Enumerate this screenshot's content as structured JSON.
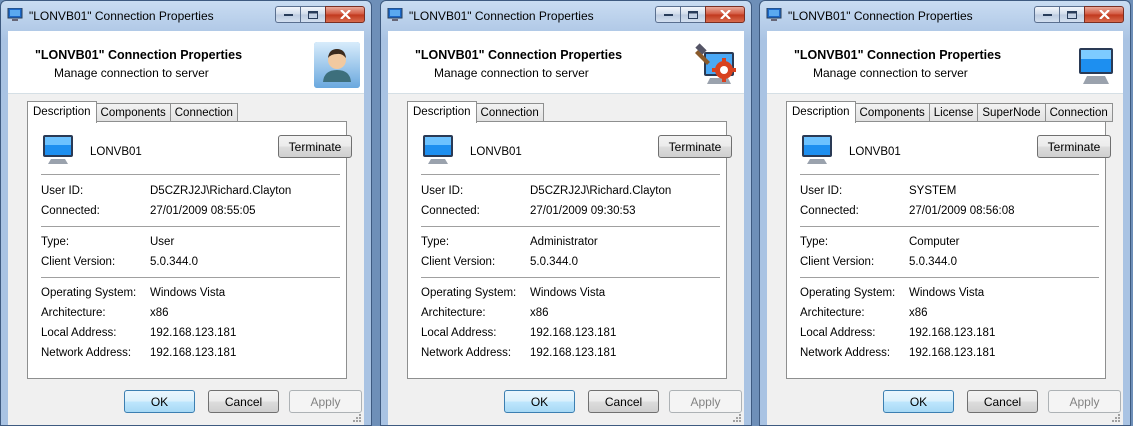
{
  "colors": {
    "accent": "#3c7fb1",
    "chrome": "#a9c3e3",
    "close_red": "#c0371c"
  },
  "windows": [
    {
      "title": "\"LONVB01\" Connection Properties",
      "header_title": "\"LONVB01\" Connection Properties",
      "header_subtitle": "Manage connection to server",
      "header_icon": "user-icon",
      "tabs": [
        "Description",
        "Components",
        "Connection"
      ],
      "computer_name": "LONVB01",
      "terminate_label": "Terminate",
      "user_id_label": "User ID:",
      "user_id": "D5CZRJ2J\\Richard.Clayton",
      "connected_label": "Connected:",
      "connected": "27/01/2009 08:55:05",
      "type_label": "Type:",
      "type": "User",
      "client_version_label": "Client Version:",
      "client_version": "5.0.344.0",
      "os_label": "Operating System:",
      "os": "Windows Vista",
      "arch_label": "Architecture:",
      "arch": "x86",
      "local_label": "Local Address:",
      "local_address": "192.168.123.181",
      "network_label": "Network Address:",
      "network_address": "192.168.123.181",
      "ok_label": "OK",
      "cancel_label": "Cancel",
      "apply_label": "Apply"
    },
    {
      "title": "\"LONVB01\" Connection Properties",
      "header_title": "\"LONVB01\" Connection Properties",
      "header_subtitle": "Manage connection to server",
      "header_icon": "admin-tools-icon",
      "tabs": [
        "Description",
        "Connection"
      ],
      "computer_name": "LONVB01",
      "terminate_label": "Terminate",
      "user_id_label": "User ID:",
      "user_id": "D5CZRJ2J\\Richard.Clayton",
      "connected_label": "Connected:",
      "connected": "27/01/2009 09:30:53",
      "type_label": "Type:",
      "type": "Administrator",
      "client_version_label": "Client Version:",
      "client_version": "5.0.344.0",
      "os_label": "Operating System:",
      "os": "Windows Vista",
      "arch_label": "Architecture:",
      "arch": "x86",
      "local_label": "Local Address:",
      "local_address": "192.168.123.181",
      "network_label": "Network Address:",
      "network_address": "192.168.123.181",
      "ok_label": "OK",
      "cancel_label": "Cancel",
      "apply_label": "Apply"
    },
    {
      "title": "\"LONVB01\" Connection Properties",
      "header_title": "\"LONVB01\" Connection Properties",
      "header_subtitle": "Manage connection to server",
      "header_icon": "monitor-icon",
      "tabs": [
        "Description",
        "Components",
        "License",
        "SuperNode",
        "Connection"
      ],
      "computer_name": "LONVB01",
      "terminate_label": "Terminate",
      "user_id_label": "User ID:",
      "user_id": "SYSTEM",
      "connected_label": "Connected:",
      "connected": "27/01/2009 08:56:08",
      "type_label": "Type:",
      "type": "Computer",
      "client_version_label": "Client Version:",
      "client_version": "5.0.344.0",
      "os_label": "Operating System:",
      "os": "Windows Vista",
      "arch_label": "Architecture:",
      "arch": "x86",
      "local_label": "Local Address:",
      "local_address": "192.168.123.181",
      "network_label": "Network Address:",
      "network_address": "192.168.123.181",
      "ok_label": "OK",
      "cancel_label": "Cancel",
      "apply_label": "Apply"
    }
  ]
}
